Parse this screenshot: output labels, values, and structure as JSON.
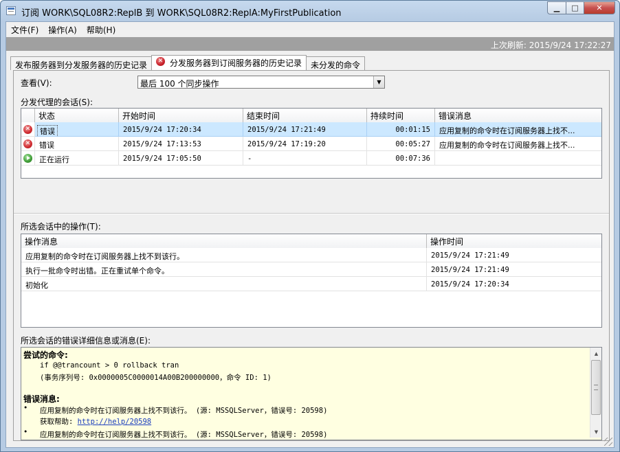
{
  "window": {
    "title": "订阅 WORK\\SQL08R2:ReplB 到 WORK\\SQL08R2:ReplA:MyFirstPublication",
    "min_glyph": "▁",
    "max_glyph": "□",
    "close_glyph": "✕"
  },
  "menu": [
    "文件(F)",
    "操作(A)",
    "帮助(H)"
  ],
  "status": {
    "last_refresh": "上次刷新: 2015/9/24 17:22:27"
  },
  "tabs": [
    {
      "label": "发布服务器到分发服务器的历史记录",
      "active": false
    },
    {
      "label": "分发服务器到订阅服务器的历史记录",
      "active": true,
      "icon": "error-icon"
    },
    {
      "label": "未分发的命令",
      "active": false
    }
  ],
  "view": {
    "label": "查看(V):",
    "selected": "最后 100 个同步操作"
  },
  "sessions": {
    "label": "分发代理的会话(S):",
    "columns": [
      "状态",
      "开始时间",
      "结束时间",
      "持续时间",
      "错误消息"
    ],
    "rows": [
      {
        "icon": "error-icon",
        "status": "错误",
        "start": "2015/9/24 17:20:34",
        "end": "2015/9/24 17:21:49",
        "duration": "00:01:15",
        "error": "应用复制的命令时在订阅服务器上找不...",
        "selected": true
      },
      {
        "icon": "error-icon",
        "status": "错误",
        "start": "2015/9/24 17:13:53",
        "end": "2015/9/24 17:19:20",
        "duration": "00:05:27",
        "error": "应用复制的命令时在订阅服务器上找不..."
      },
      {
        "icon": "running-icon",
        "status": "正在运行",
        "start": "2015/9/24 17:05:50",
        "end": "-",
        "duration": "00:07:36",
        "error": ""
      }
    ]
  },
  "actions": {
    "label": "所选会话中的操作(T):",
    "columns": [
      "操作消息",
      "操作时间"
    ],
    "rows": [
      {
        "message": "应用复制的命令时在订阅服务器上找不到该行。",
        "time": "2015/9/24 17:21:49"
      },
      {
        "message": "执行一批命令时出错。正在重试单个命令。",
        "time": "2015/9/24 17:21:49"
      },
      {
        "message": "初始化",
        "time": "2015/9/24 17:20:34"
      }
    ]
  },
  "details": {
    "label": "所选会话的错误详细信息或消息(E):",
    "attempted_heading": "尝试的命令:",
    "command": "if @@trancount > 0 rollback tran",
    "transaction": "(事务序列号: 0x0000005C0000014A00B200000000，命令 ID: 1)",
    "error_heading": "错误消息:",
    "bullet": "•",
    "error1": "应用复制的命令时在订阅服务器上找不到该行。 (源: MSSQLServer，错误号: 20598)",
    "help_label": "获取帮助:",
    "help_link": "http://help/20598",
    "error2": "应用复制的命令时在订阅服务器上找不到该行。 (源: MSSQLServer，错误号: 20598)",
    "scroll_up": "▲",
    "scroll_down": "▼"
  },
  "icons": {
    "error_glyph": "✕",
    "combo_arrow": "▼"
  },
  "colors": {
    "selection": "#cce8ff",
    "details_background": "#ffffe1",
    "status_strip": "#a0a0a0",
    "link": "#1a3cbd"
  }
}
